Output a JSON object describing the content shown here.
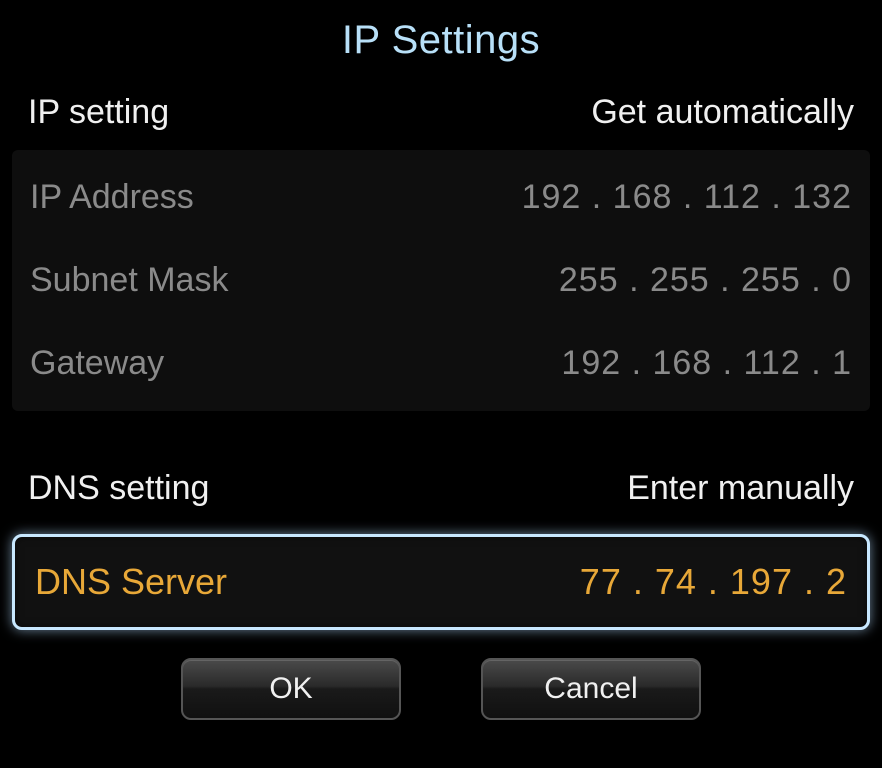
{
  "title": "IP Settings",
  "ip_section": {
    "label": "IP setting",
    "mode": "Get automatically",
    "rows": {
      "ip_address": {
        "label": "IP Address",
        "value": "192 . 168 . 112 . 132"
      },
      "subnet_mask": {
        "label": "Subnet Mask",
        "value": "255 . 255 . 255 . 0"
      },
      "gateway": {
        "label": "Gateway",
        "value": "192 . 168 . 112 . 1"
      }
    }
  },
  "dns_section": {
    "label": "DNS setting",
    "mode": "Enter manually",
    "server": {
      "label": "DNS Server",
      "value": "77 . 74 . 197 . 2"
    }
  },
  "buttons": {
    "ok": "OK",
    "cancel": "Cancel"
  }
}
